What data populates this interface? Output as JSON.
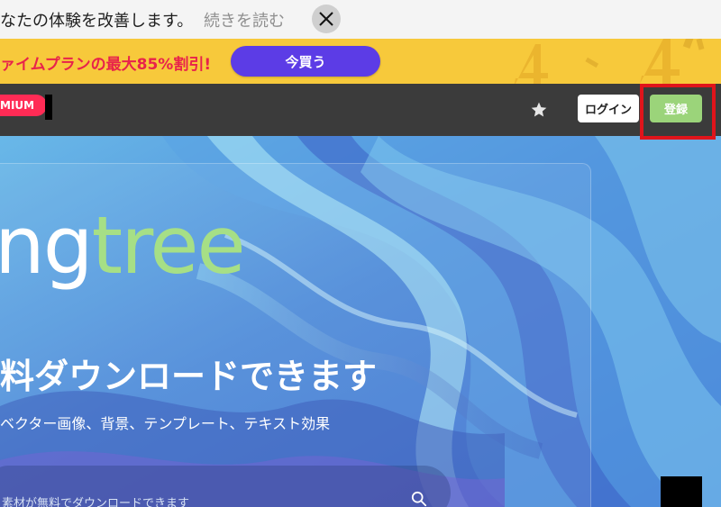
{
  "notice": {
    "text": "なたの体験を改善します。",
    "link": "続きを読む"
  },
  "promo": {
    "text": "ァイムプランの最大85%割引!",
    "button": "今買う"
  },
  "header": {
    "premium_badge": "MIUM",
    "login": "ログイン",
    "register": "登録"
  },
  "hero": {
    "logo_part1": "ng",
    "logo_part2": "tree",
    "title": "料ダウンロードできます",
    "subtitle": "ベクター画像、背景、テンプレート、テキスト効果",
    "search_placeholder": "素材が無料でダウンロードできます"
  },
  "colors": {
    "promo_bg": "#f7c93b",
    "promo_text": "#e8234b",
    "promo_button": "#5c3ce6",
    "header_bg": "#3b3b3b",
    "premium": "#ff2b55",
    "register": "#9bd47a",
    "logo_green": "#a6df86",
    "highlight": "#e0141b"
  },
  "icons": {
    "close": "close-icon",
    "star": "star-icon",
    "search": "search-icon"
  }
}
